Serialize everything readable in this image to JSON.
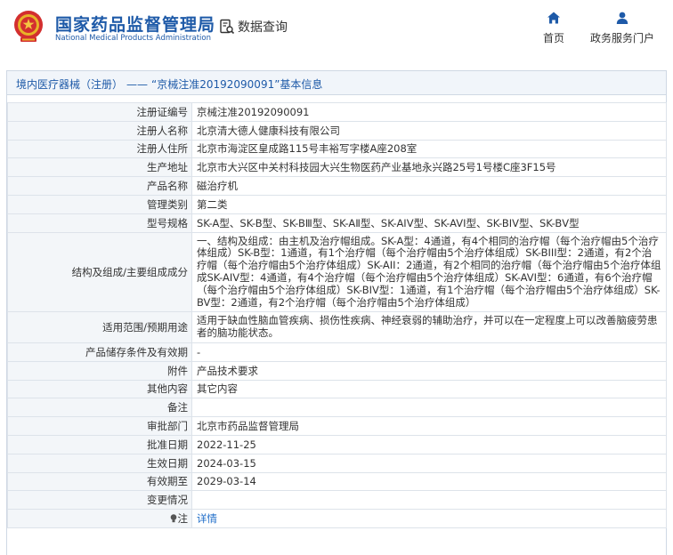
{
  "header": {
    "site_title_cn": "国家药品监督管理局",
    "site_title_en": "National Medical Products Administration",
    "data_query_label": "数据查询",
    "nav_home_label": "首页",
    "nav_portal_label": "政务服务门户",
    "brand_color": "#1e5aa8",
    "emblem_color": "#d32f2f"
  },
  "breadcrumb": {
    "category": "境内医疗器械（注册）",
    "separator": "——",
    "record_title": "“京械注准20192090091”基本信息"
  },
  "rows": [
    {
      "key": "注册证编号",
      "value": "京械注准20192090091"
    },
    {
      "key": "注册人名称",
      "value": "北京清大德人健康科技有限公司"
    },
    {
      "key": "注册人住所",
      "value": "北京市海淀区皇成路115号丰裕写字楼A座208室"
    },
    {
      "key": "生产地址",
      "value": "北京市大兴区中关村科技园大兴生物医药产业基地永兴路25号1号楼C座3F15号"
    },
    {
      "key": "产品名称",
      "value": "磁治疗机"
    },
    {
      "key": "管理类别",
      "value": "第二类"
    },
    {
      "key": "型号规格",
      "value": "SK-A型、SK-B型、SK-BⅢ型、SK-AⅡ型、SK-AIV型、SK-AVI型、SK-BIV型、SK-BⅤ型"
    },
    {
      "key": "结构及组成/主要组成成分",
      "value": "一、结构及组成：由主机及治疗帽组成。SK-A型：4通道，有4个相同的治疗帽（每个治疗帽由5个治疗体组成）SK-B型：1通道，有1个治疗帽（每个治疗帽由5个治疗体组成）SK-BIII型：2通道，有2个治疗帽（每个治疗帽由5个治疗体组成）SK-AII：2通道，有2个相同的治疗帽（每个治疗帽由5个治疗体组成SK-AIV型：4通道，有4个治疗帽（每个治疗帽由5个治疗体组成）SK-AVI型：6通道，有6个治疗帽（每个治疗帽由5个治疗体组成）SK-BIV型：1通道，有1个治疗帽（每个治疗帽由5个治疗体组成）SK-BV型：2通道，有2个治疗帽（每个治疗帽由5个治疗体组成）"
    },
    {
      "key": "适用范围/预期用途",
      "value": "适用于缺血性脑血管疾病、损伤性疾病、神经衰弱的辅助治疗，并可以在一定程度上可以改善脑疲劳患者的脑功能状态。"
    },
    {
      "key": "产品储存条件及有效期",
      "value": "-"
    },
    {
      "key": "附件",
      "value": "产品技术要求"
    },
    {
      "key": "其他内容",
      "value": "其它内容"
    },
    {
      "key": "备注",
      "value": ""
    },
    {
      "key": "审批部门",
      "value": "北京市药品监督管理局"
    },
    {
      "key": "批准日期",
      "value": "2022-11-25"
    },
    {
      "key": "生效日期",
      "value": "2024-03-15"
    },
    {
      "key": "有效期至",
      "value": "2029-03-14"
    },
    {
      "key": "变更情况",
      "value": ""
    },
    {
      "key": "注",
      "value": "详情"
    }
  ]
}
